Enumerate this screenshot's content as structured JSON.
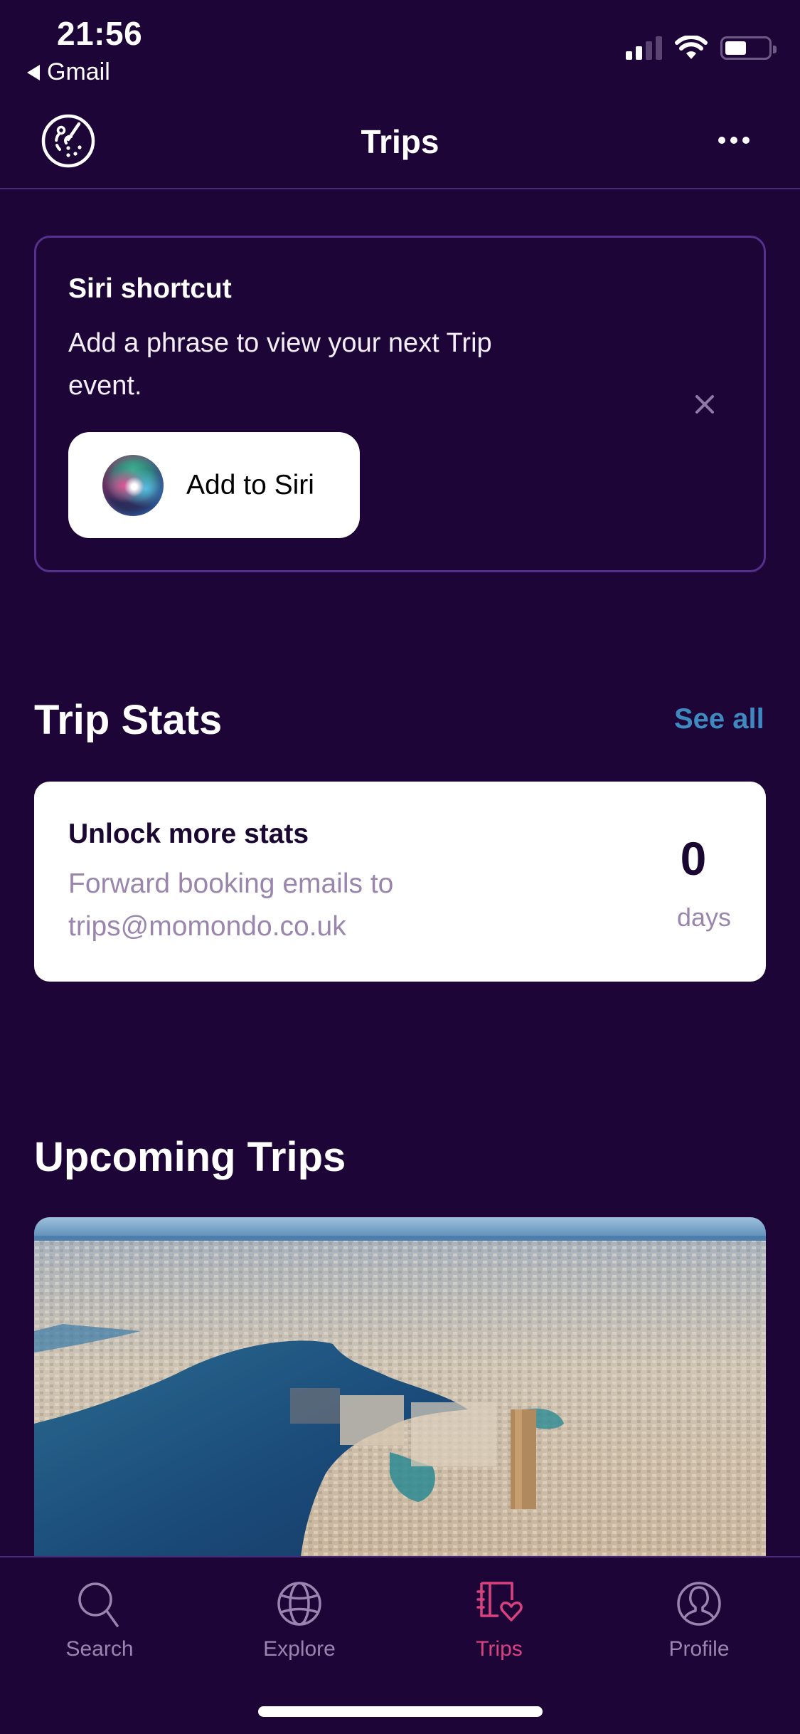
{
  "status_bar": {
    "time": "21:56",
    "back_app": "Gmail",
    "signal_bars_active": 2,
    "signal_bars_total": 4,
    "battery_level": 0.5,
    "wifi": "wifi-icon"
  },
  "header": {
    "title": "Trips",
    "left_icon": "radar-icon",
    "right_icon": "more-icon"
  },
  "siri_card": {
    "title": "Siri shortcut",
    "description": "Add a phrase to view your next Trip event.",
    "button_label": "Add to Siri",
    "close_icon": "close-icon"
  },
  "trip_stats": {
    "title": "Trip Stats",
    "see_all": "See all",
    "card": {
      "heading": "Unlock more stats",
      "description": "Forward booking emails to trips@momondo.co.uk",
      "value": "0",
      "unit": "days"
    }
  },
  "upcoming_trips": {
    "title": "Upcoming Trips",
    "photo": "aerial-city-harbour-photo"
  },
  "tabbar": {
    "tabs": [
      {
        "label": "Search",
        "icon": "search-icon",
        "active": false
      },
      {
        "label": "Explore",
        "icon": "globe-icon",
        "active": false
      },
      {
        "label": "Trips",
        "icon": "trips-notebook-heart-icon",
        "active": true
      },
      {
        "label": "Profile",
        "icon": "profile-icon",
        "active": false
      }
    ]
  },
  "colors": {
    "background": "#1e0538",
    "card_border": "#56318c",
    "accent_link": "#3f89bf",
    "active_tab": "#d9417f",
    "inactive_tab": "#9a84b0",
    "muted_text": "#9a86ad"
  }
}
